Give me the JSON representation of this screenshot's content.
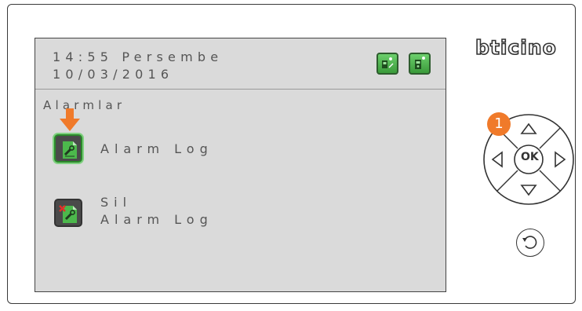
{
  "screen": {
    "time_line": "14:55 Persembe",
    "date_line": "10/03/2016",
    "section_title": "Alarmlar",
    "menu_items": [
      {
        "label_line1": "Alarm Log",
        "label_line2": "",
        "icon": "alarm-log-icon",
        "selected": true
      },
      {
        "label_line1": "Sil",
        "label_line2": "Alarm Log",
        "icon": "delete-alarm-log-icon",
        "selected": false
      }
    ],
    "status_icons": [
      "intercom-status-icon",
      "intercom-lit-status-icon"
    ]
  },
  "device": {
    "brand": "bticino",
    "ok_label": "OK",
    "callout_number": "1"
  },
  "colors": {
    "screen_bg": "#dadada",
    "icon_green": "#4cb84c",
    "callout_orange": "#f07a2a",
    "text_gray": "#555555"
  }
}
